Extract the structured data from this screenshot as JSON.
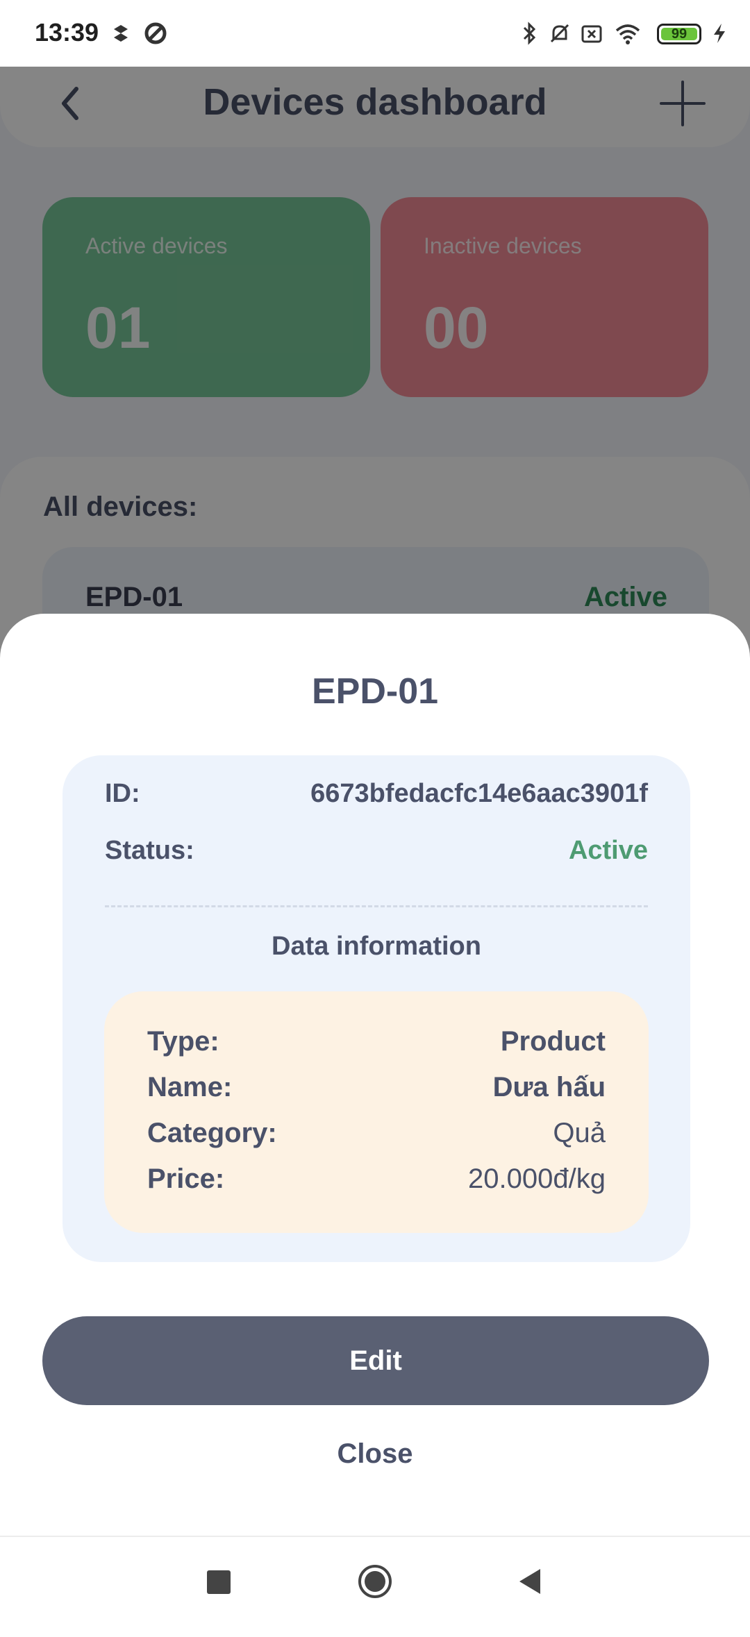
{
  "status_bar": {
    "time": "13:39",
    "battery": "99",
    "icons": [
      "dropbox-icon",
      "sync-icon",
      "bluetooth-icon",
      "bell-off-icon",
      "sim-x-icon",
      "wifi-icon",
      "battery-icon",
      "charging-icon"
    ]
  },
  "header": {
    "title": "Devices dashboard",
    "back_icon": "chevron-left-icon",
    "add_icon": "plus-icon"
  },
  "stats": {
    "active": {
      "label": "Active devices",
      "value": "01",
      "color": "#78c79a"
    },
    "inactive": {
      "label": "Inactive devices",
      "value": "00",
      "color": "#f38c98"
    }
  },
  "devices": {
    "title": "All devices:",
    "items": [
      {
        "name": "EPD-01",
        "status": "Active"
      }
    ]
  },
  "sheet": {
    "title": "EPD-01",
    "id_label": "ID:",
    "id_value": "6673bfedacfc14e6aac3901f",
    "status_label": "Status:",
    "status_value": "Active",
    "data_title": "Data information",
    "data": {
      "type_label": "Type:",
      "type_value": "Product",
      "name_label": "Name:",
      "name_value": "Dưa hấu",
      "category_label": "Category:",
      "category_value": "Quả",
      "price_label": "Price:",
      "price_value": "20.000đ/kg"
    },
    "edit_label": "Edit",
    "close_label": "Close"
  },
  "colors": {
    "status_active": "#4e9b72",
    "primary_button": "#5a6073",
    "info_card": "#edf3fc",
    "data_card": "#fdf2e3"
  }
}
